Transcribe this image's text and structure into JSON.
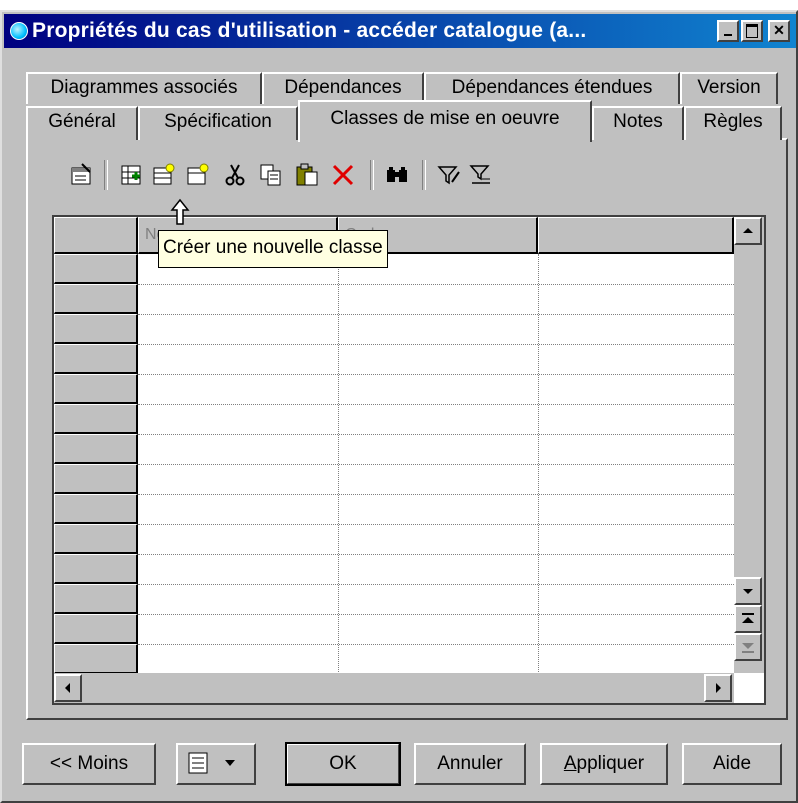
{
  "window": {
    "title": "Propriétés du cas d'utilisation - accéder catalogue (a..."
  },
  "tabs_row1": [
    "Diagrammes associés",
    "Dépendances",
    "Dépendances étendues",
    "Version"
  ],
  "tabs_row2": [
    "Général",
    "Spécification",
    "Classes de mise en oeuvre",
    "Notes",
    "Règles"
  ],
  "active_tab": "Classes de mise en oeuvre",
  "toolbar": {
    "icons": [
      "properties-icon",
      "add-objects-icon",
      "create-class-icon",
      "create-object-icon",
      "cut-icon",
      "copy-icon",
      "paste-icon",
      "delete-icon",
      "find-icon",
      "filter-icon",
      "clear-filter-icon"
    ]
  },
  "grid": {
    "columns": [
      "Nom",
      "Code"
    ],
    "row_count": 13
  },
  "tooltip": "Créer une nouvelle classe",
  "buttons": {
    "less": "<< Moins",
    "ok": "OK",
    "cancel": "Annuler",
    "apply_underlined": "A",
    "apply_rest": "ppliquer",
    "help": "Aide"
  },
  "colors": {
    "title_start": "#000080",
    "title_end": "#1084d0",
    "face": "#c0c0c0",
    "tooltip_bg": "#ffffe1"
  }
}
